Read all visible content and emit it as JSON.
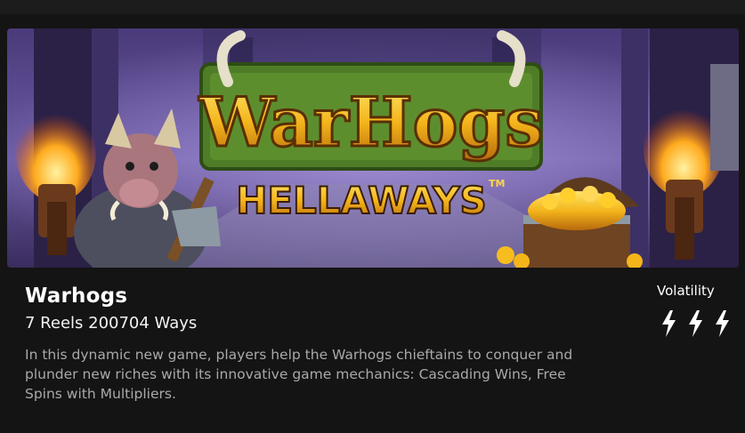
{
  "banner": {
    "logo_main": "WarHogs",
    "logo_sub": "HELLAWAYS",
    "logo_tm": "TM"
  },
  "game": {
    "title": "Warhogs",
    "subtitle": "7 Reels 200704 Ways",
    "description": "In this dynamic new game, players help the Warhogs chieftains to conquer and plunder new riches with its innovative game mechanics: Cascading Wins, Free Spins with Multipliers."
  },
  "volatility": {
    "label": "Volatility",
    "level": 3,
    "max": 3,
    "icon": "lightning-bolt-icon"
  },
  "colors": {
    "background": "#141414",
    "title": "#ffffff",
    "description": "#a9a9a9",
    "logo_gold": "#f4c21b",
    "logo_green": "#5e8a2d"
  }
}
